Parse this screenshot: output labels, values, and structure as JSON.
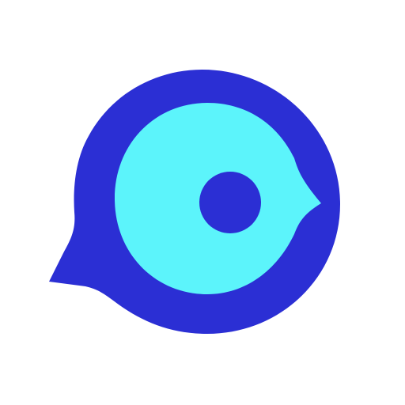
{
  "logo": {
    "name": "chat-eye-logo",
    "colors": {
      "background": "#ffffff",
      "outer": "#2b2fd4",
      "inner": "#5cf4fb",
      "pupil": "#2b2fd4"
    }
  }
}
